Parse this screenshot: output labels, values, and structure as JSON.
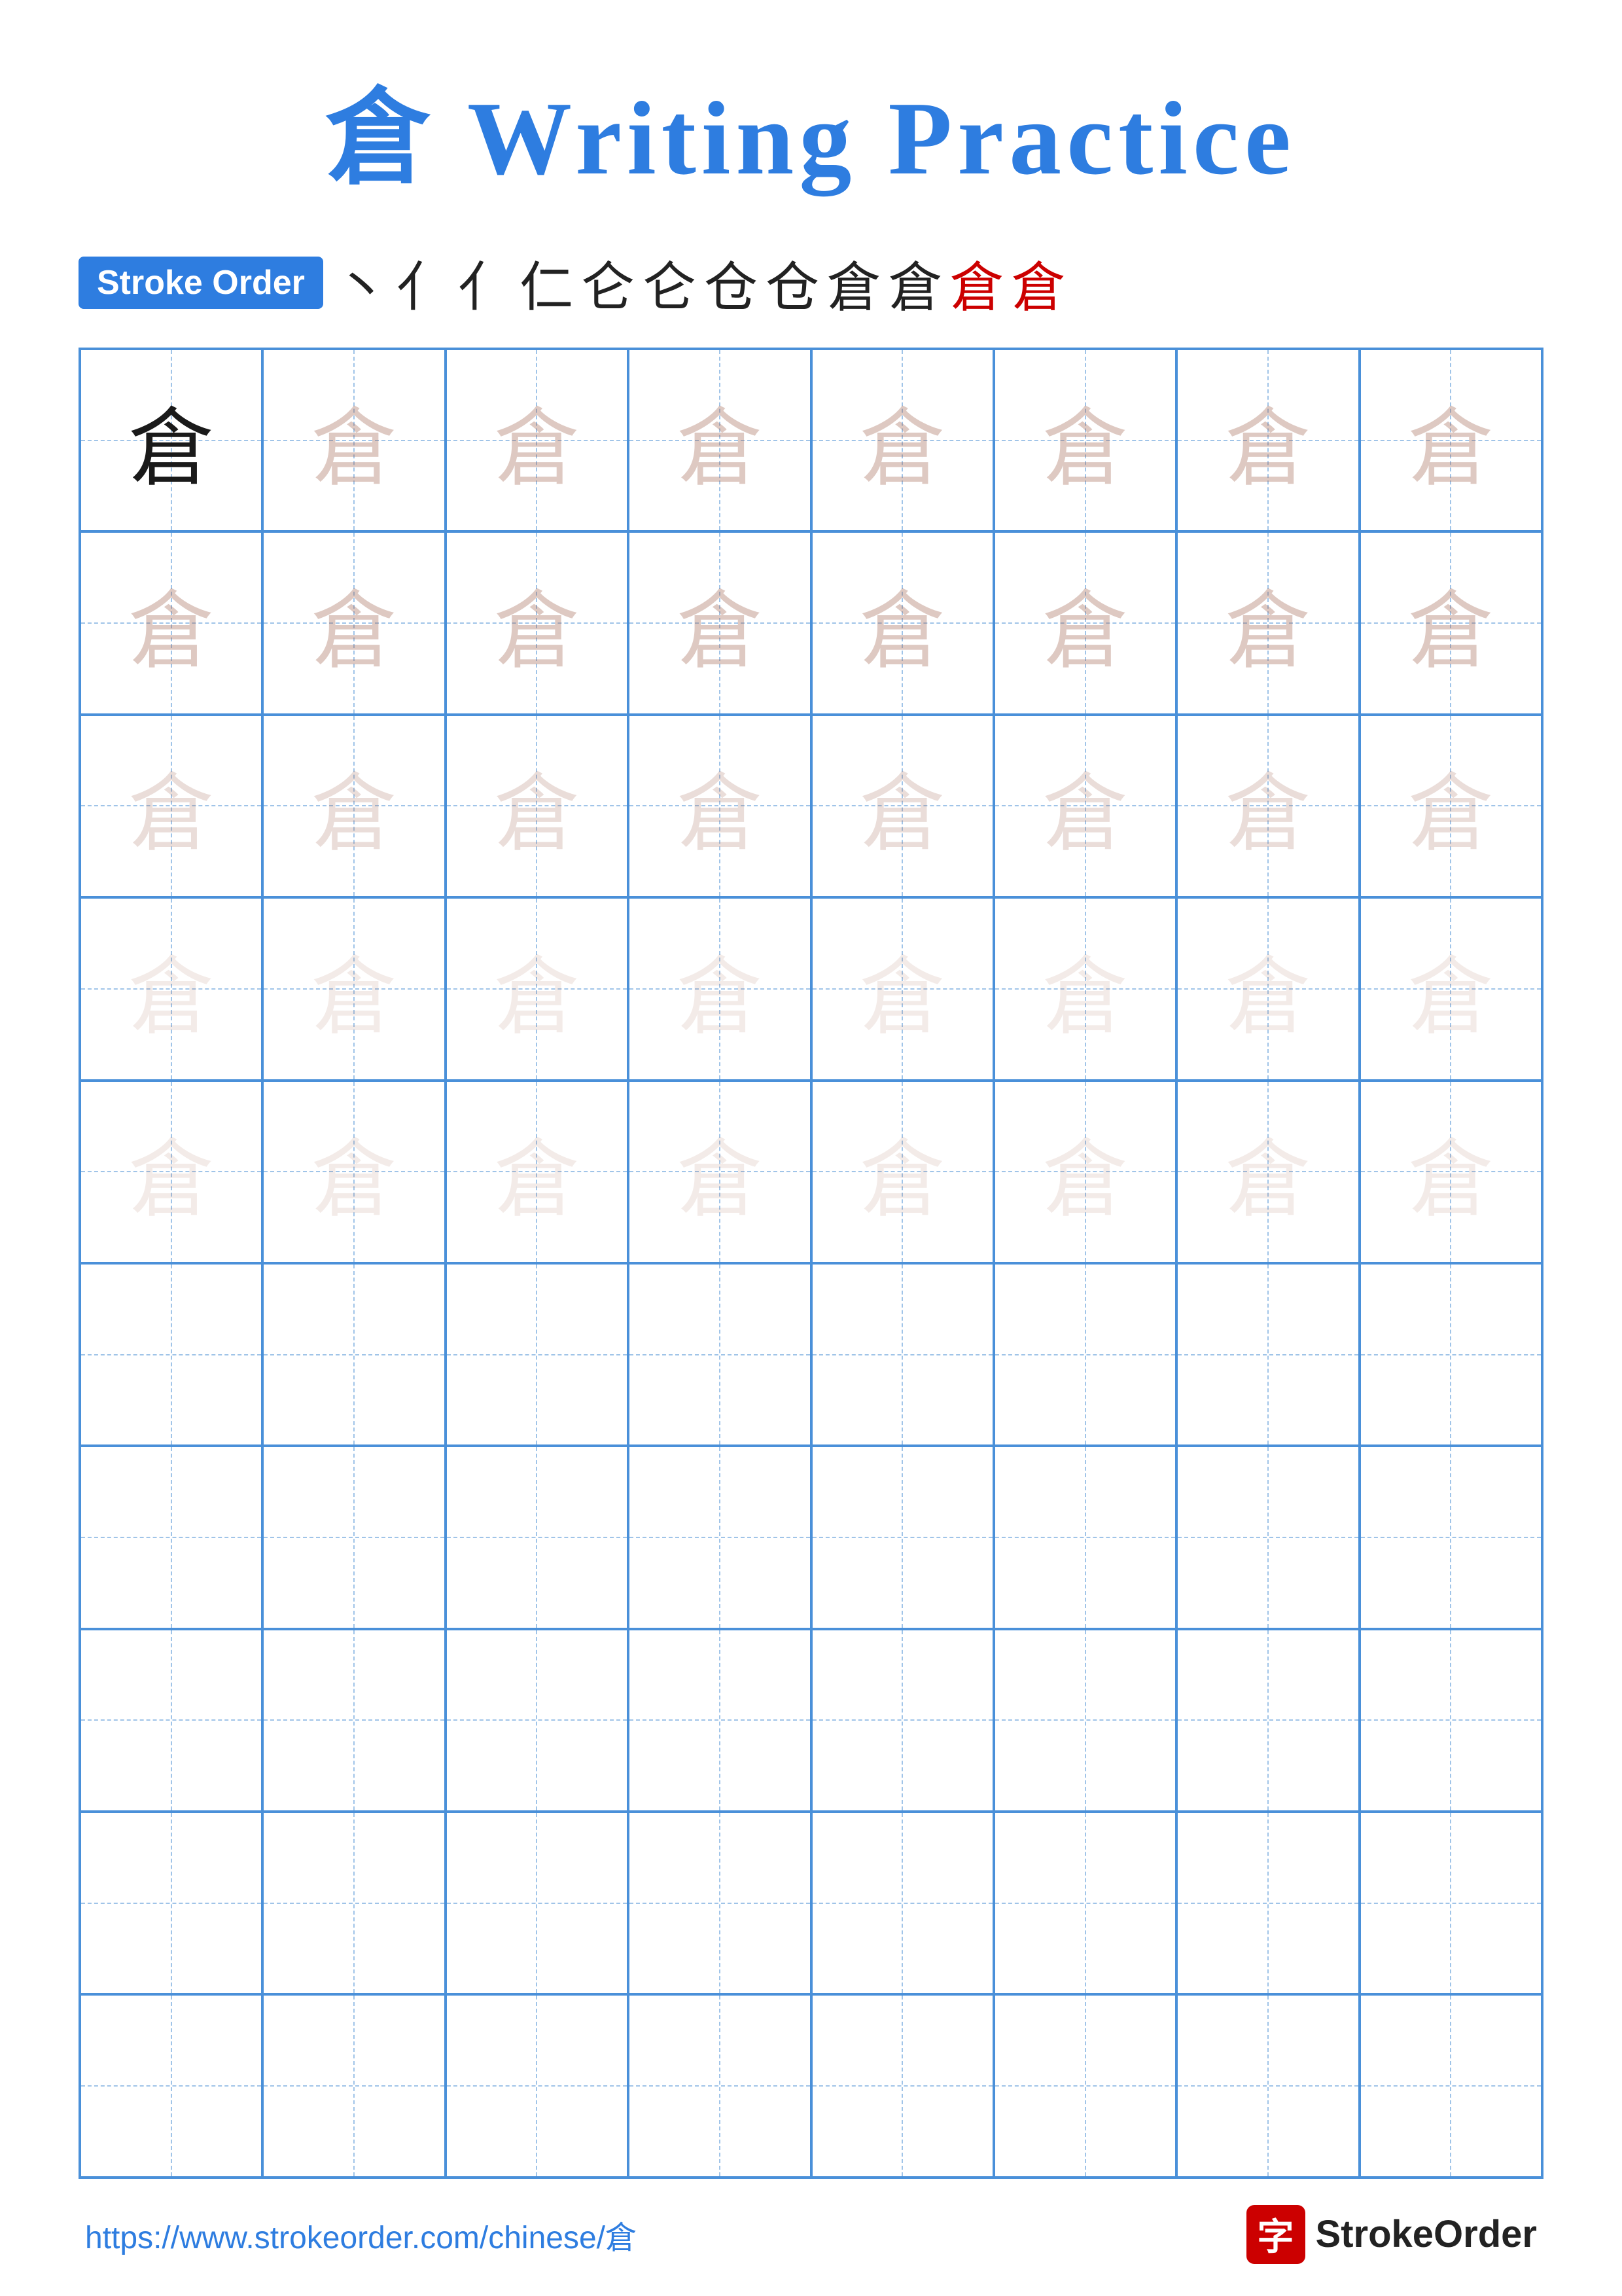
{
  "page": {
    "title": "倉 Writing Practice",
    "character": "倉",
    "stroke_order_label": "Stroke Order",
    "stroke_order_chars": [
      "丶",
      "亻",
      "亻",
      "仁",
      "仑",
      "仑",
      "仓",
      "仓",
      "倉",
      "倉",
      "倉",
      "倉"
    ],
    "footer_url": "https://www.strokeorder.com/chinese/倉",
    "footer_logo_char": "字",
    "footer_logo_text": "StrokeOrder"
  },
  "grid": {
    "cols": 8,
    "rows": 10,
    "guide_char": "倉"
  }
}
